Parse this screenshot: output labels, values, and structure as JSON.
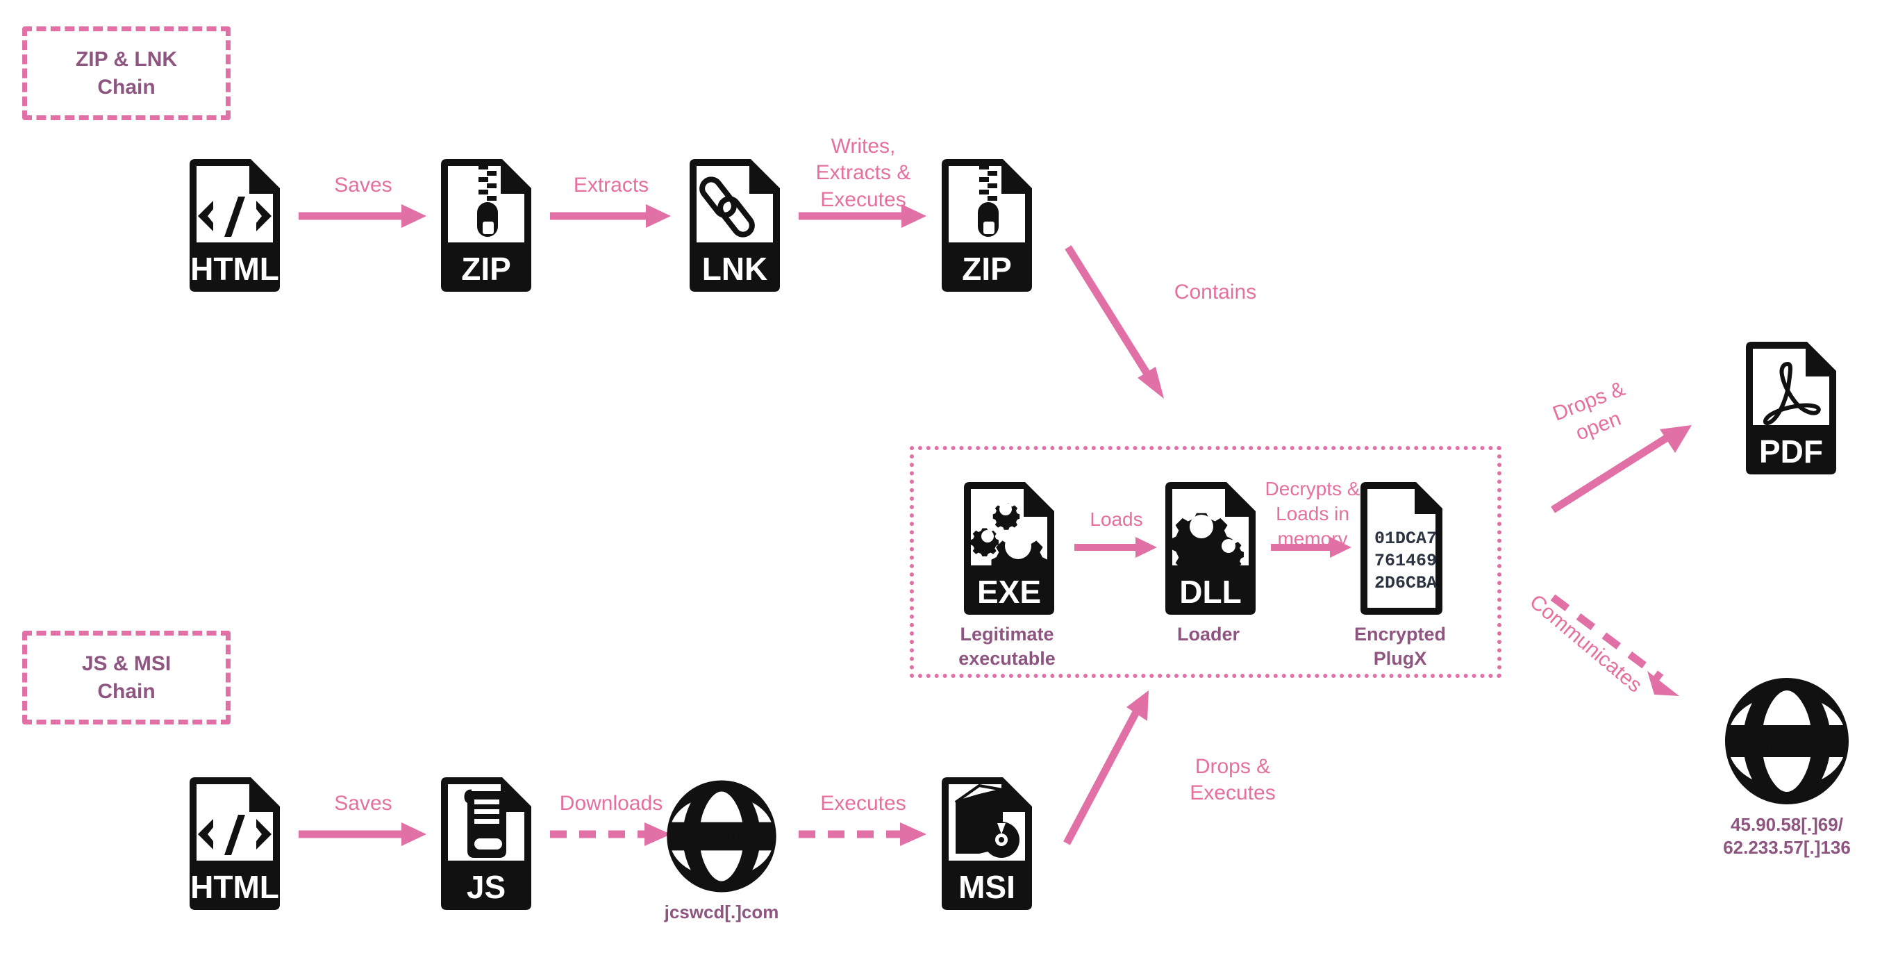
{
  "colors": {
    "pink": "#e070a5",
    "pink_text": "#e570a0",
    "purple": "#8e5580",
    "black": "#111111",
    "hex_text": "#2b3440",
    "background": "#ffffff"
  },
  "chains": [
    {
      "id": "zip-lnk",
      "label": "ZIP & LNK\nChain"
    },
    {
      "id": "js-msi",
      "label": "JS & MSI\nChain"
    }
  ],
  "group_box": {
    "id": "sideload-group",
    "label": ""
  },
  "nodes": {
    "html_top": {
      "icon": "html-file-icon",
      "type": "file",
      "badge": "HTML",
      "caption": ""
    },
    "zip_first": {
      "icon": "zip-file-icon",
      "type": "file",
      "badge": "ZIP",
      "caption": ""
    },
    "lnk": {
      "icon": "lnk-file-icon",
      "type": "file",
      "badge": "LNK",
      "caption": ""
    },
    "zip_second": {
      "icon": "zip-file-icon",
      "type": "file",
      "badge": "ZIP",
      "caption": ""
    },
    "exe": {
      "icon": "exe-file-icon",
      "type": "file",
      "badge": "EXE",
      "caption": "Legitimate\nexecutable"
    },
    "dll": {
      "icon": "dll-file-icon",
      "type": "file",
      "badge": "DLL",
      "caption": "Loader"
    },
    "encrypted": {
      "icon": "encrypted-payload-file-icon",
      "type": "file-hex",
      "badge": "",
      "hex_lines": [
        "01DCA7",
        "761469",
        "2D6CBA"
      ],
      "caption": "Encrypted\nPlugX"
    },
    "pdf": {
      "icon": "pdf-file-icon",
      "type": "file",
      "badge": "PDF",
      "caption": ""
    },
    "c2_globe": {
      "icon": "globe-www-icon",
      "type": "globe",
      "caption": "45.90.58[.]69/\n62.233.57[.]136"
    },
    "html_bottom": {
      "icon": "html-file-icon",
      "type": "file",
      "badge": "HTML",
      "caption": ""
    },
    "js": {
      "icon": "js-file-icon",
      "type": "file",
      "badge": "JS",
      "caption": ""
    },
    "download_globe": {
      "icon": "globe-www-icon",
      "type": "globe",
      "caption": "jcswcd[.]com"
    },
    "msi": {
      "icon": "msi-file-icon",
      "type": "file",
      "badge": "MSI",
      "caption": ""
    }
  },
  "edges": [
    {
      "id": "html-to-zip",
      "label": "Saves",
      "style": "solid"
    },
    {
      "id": "zip-to-lnk",
      "label": "Extracts",
      "style": "solid"
    },
    {
      "id": "lnk-to-zip2",
      "label": "Writes,\nExtracts &\nExecutes",
      "style": "solid"
    },
    {
      "id": "zip2-to-group",
      "label": "Contains",
      "style": "solid"
    },
    {
      "id": "exe-to-dll",
      "label": "Loads",
      "style": "solid"
    },
    {
      "id": "dll-to-payload",
      "label": "Decrypts &\nLoads in\nmemory",
      "style": "solid"
    },
    {
      "id": "group-to-pdf",
      "label": "Drops &\nopen",
      "style": "solid"
    },
    {
      "id": "group-to-c2",
      "label": "Communicates",
      "style": "dashed"
    },
    {
      "id": "html2-to-js",
      "label": "Saves",
      "style": "solid"
    },
    {
      "id": "js-to-globe",
      "label": "Downloads",
      "style": "dashed"
    },
    {
      "id": "globe-to-msi",
      "label": "Executes",
      "style": "dashed"
    },
    {
      "id": "msi-to-group",
      "label": "Drops &\nExecutes",
      "style": "solid"
    }
  ]
}
